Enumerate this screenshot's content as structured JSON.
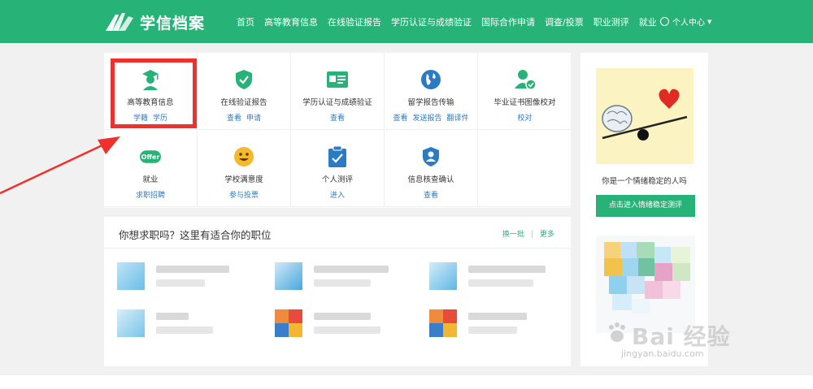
{
  "header": {
    "logo_text": "学信档案",
    "nav": [
      "首页",
      "高等教育信息",
      "在线验证报告",
      "学历认证与成绩验证",
      "国际合作申请",
      "调查/投票",
      "职业测评",
      "就业"
    ],
    "user_menu": "个人中心"
  },
  "services": [
    {
      "title": "高等教育信息",
      "links": [
        "学籍",
        "学历"
      ],
      "icon": "graduate-icon",
      "color": "#27b277"
    },
    {
      "title": "在线验证报告",
      "links": [
        "查看",
        "申请"
      ],
      "icon": "shield-check-icon",
      "color": "#27b277"
    },
    {
      "title": "学历认证与成绩验证",
      "links": [
        "查看"
      ],
      "icon": "id-card-icon",
      "color": "#27b277"
    },
    {
      "title": "留学报告传输",
      "links": [
        "查看",
        "发送报告",
        "翻译件"
      ],
      "icon": "globe-icon",
      "color": "#2b7bc4"
    },
    {
      "title": "毕业证书图像校对",
      "links": [
        "校对"
      ],
      "icon": "user-check-icon",
      "color": "#27b277"
    },
    {
      "title": "就业",
      "links": [
        "求职招聘"
      ],
      "icon": "offer-icon",
      "color": "#27b277",
      "badge": "Offer"
    },
    {
      "title": "学校满意度",
      "links": [
        "参与投票"
      ],
      "icon": "smile-icon",
      "color": "#f5b82e"
    },
    {
      "title": "个人测评",
      "links": [
        "进入"
      ],
      "icon": "clipboard-check-icon",
      "color": "#2b7bc4"
    },
    {
      "title": "信息核查确认",
      "links": [
        "查看"
      ],
      "icon": "user-shield-icon",
      "color": "#2b7bc4"
    }
  ],
  "jobs": {
    "title": "你想求职吗？这里有适合你的职位",
    "refresh": "换一批",
    "more": "更多"
  },
  "side": {
    "caption": "你是一个情绪稳定的人吗",
    "button": "点击进入情绪稳定测评"
  },
  "watermark": {
    "text": "Bai 经验",
    "sub": "jingyan.baidu.com"
  },
  "colors": {
    "brand": "#27b277",
    "link": "#2b7bc4",
    "highlight": "#f0302d"
  }
}
